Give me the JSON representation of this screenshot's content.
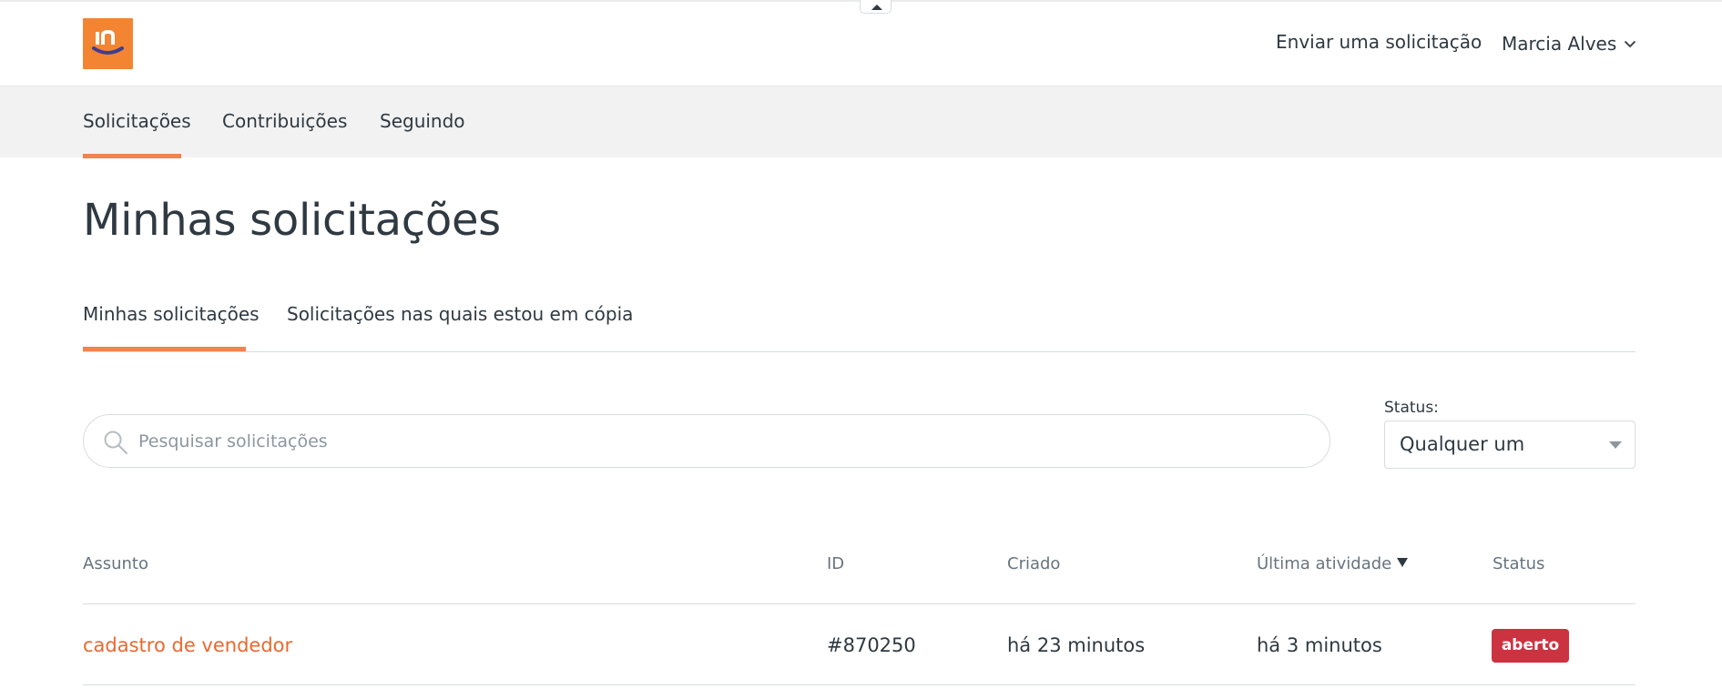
{
  "header": {
    "logo_name": "brand-logo",
    "submit_request_label": "Enviar uma solicitação",
    "user_name": "Marcia Alves"
  },
  "subnav": {
    "items": [
      {
        "label": "Solicitações",
        "active": true
      },
      {
        "label": "Contribuições",
        "active": false
      },
      {
        "label": "Seguindo",
        "active": false
      }
    ]
  },
  "page": {
    "title": "Minhas solicitações"
  },
  "tabs": [
    {
      "label": "Minhas solicitações",
      "active": true
    },
    {
      "label": "Solicitações nas quais estou em cópia",
      "active": false
    }
  ],
  "search": {
    "placeholder": "Pesquisar solicitações",
    "value": ""
  },
  "status_filter": {
    "label": "Status:",
    "selected": "Qualquer um"
  },
  "table": {
    "headers": {
      "subject": "Assunto",
      "id": "ID",
      "created": "Criado",
      "last_activity": "Última atividade",
      "status": "Status"
    },
    "sorted_by": "last_activity",
    "rows": [
      {
        "subject": "cadastro de vendedor",
        "id": "#870250",
        "created": "há 23 minutos",
        "last_activity": "há 3 minutos",
        "status": "aberto"
      }
    ]
  },
  "colors": {
    "accent": "#f0834e",
    "link": "#e8692f",
    "badge_open": "#cc3340",
    "logo_bg": "#f38532"
  }
}
